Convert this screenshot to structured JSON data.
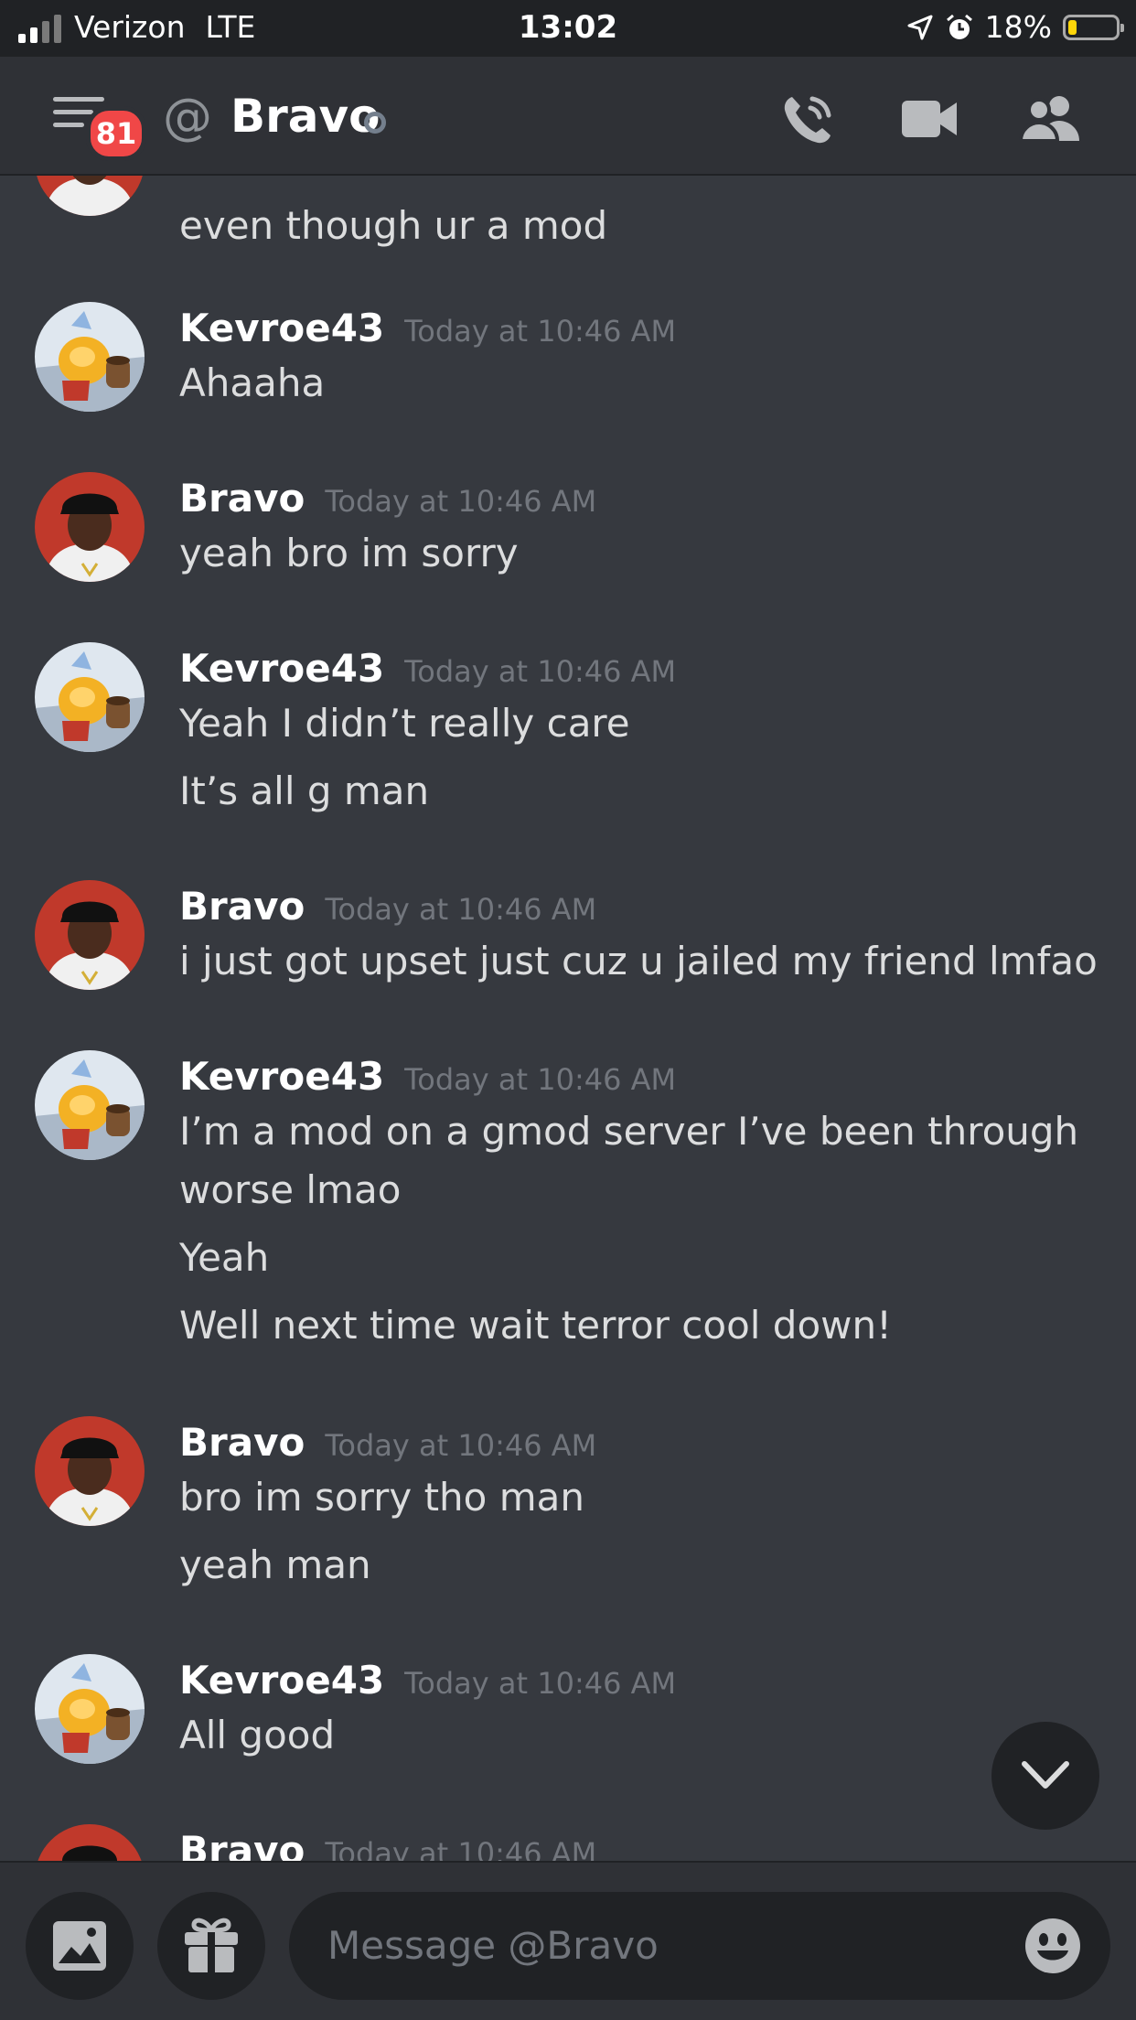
{
  "status_bar": {
    "carrier": "Verizon",
    "network": "LTE",
    "time": "13:02",
    "battery": "18%",
    "battery_level": 0.18
  },
  "header": {
    "unread_badge": "81",
    "at_symbol": "@",
    "title": "Bravo",
    "icons": [
      "menu-icon",
      "phone-call-icon",
      "video-camera-icon",
      "members-icon"
    ]
  },
  "messages": [
    {
      "author": "",
      "time": "",
      "lines": [
        "even though ur a mod"
      ],
      "avatar": "bravo"
    },
    {
      "author": "Kevroe43",
      "time": "Today at 10:46 AM",
      "lines": [
        "Ahaaha"
      ],
      "avatar": "kevroe"
    },
    {
      "author": "Bravo",
      "time": "Today at 10:46 AM",
      "lines": [
        "yeah bro im sorry"
      ],
      "avatar": "bravo"
    },
    {
      "author": "Kevroe43",
      "time": "Today at 10:46 AM",
      "lines": [
        "Yeah I didn’t really care",
        "It’s all g man"
      ],
      "avatar": "kevroe"
    },
    {
      "author": "Bravo",
      "time": "Today at 10:46 AM",
      "lines": [
        "i just got upset just cuz u jailed my friend lmfao"
      ],
      "avatar": "bravo"
    },
    {
      "author": "Kevroe43",
      "time": "Today at 10:46 AM",
      "lines": [
        "I’m a mod on a gmod server I’ve been through",
        "worse lmao",
        "Yeah",
        "Well next time wait terror cool down!"
      ],
      "avatar": "kevroe"
    },
    {
      "author": "Bravo",
      "time": "Today at 10:46 AM",
      "lines": [
        "bro im sorry tho man",
        "yeah man"
      ],
      "avatar": "bravo"
    },
    {
      "author": "Kevroe43",
      "time": "Today at 10:46 AM",
      "lines": [
        "All good"
      ],
      "avatar": "kevroe"
    },
    {
      "author": "Bravo",
      "time": "Today at 10:46 AM",
      "lines": [],
      "avatar": "bravo"
    }
  ],
  "composer": {
    "placeholder": "Message @Bravo",
    "icons": [
      "image-icon",
      "gift-icon",
      "emoji-icon"
    ]
  },
  "colors": {
    "background": "#36393f",
    "header": "#2f3136",
    "badge": "#f04747",
    "timestamp": "#72767d"
  }
}
